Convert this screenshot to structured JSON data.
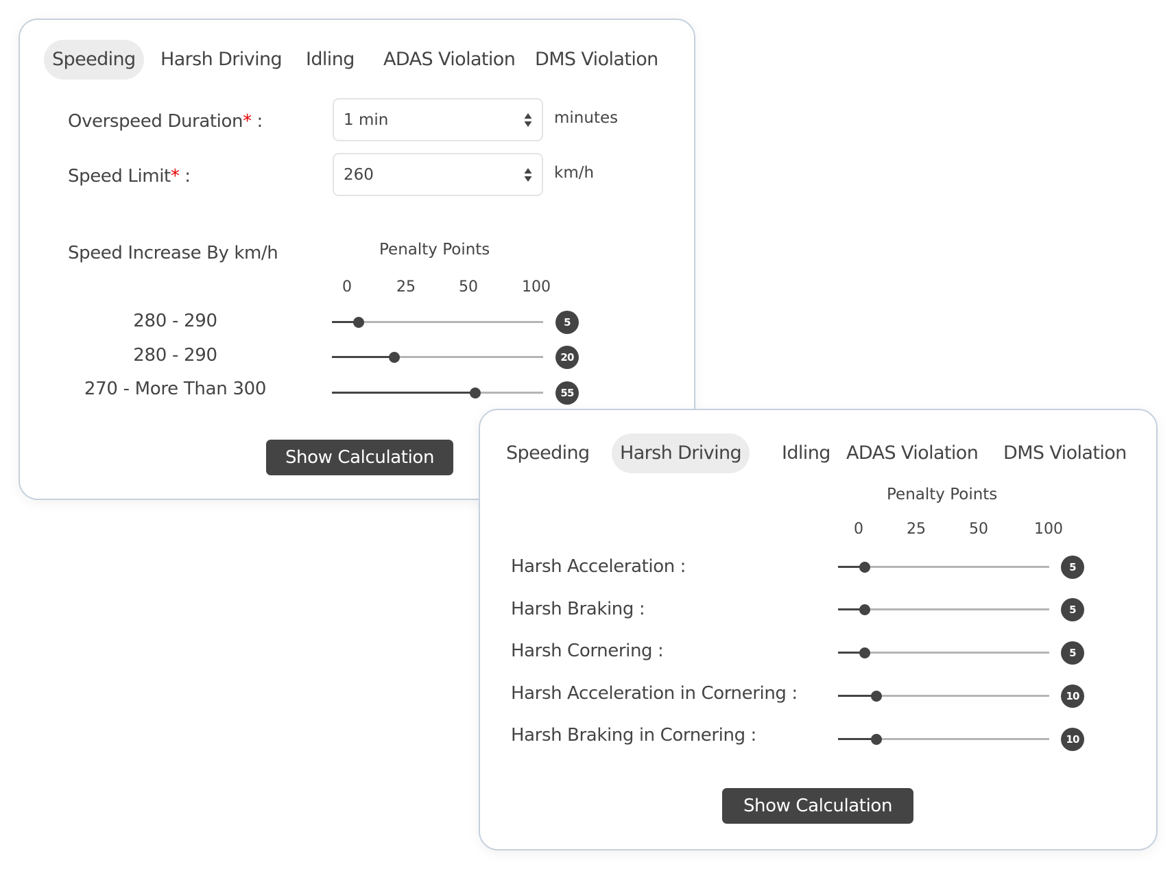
{
  "speeding_panel": {
    "tabs": [
      {
        "label": "Speeding",
        "active": true
      },
      {
        "label": "Harsh Driving",
        "active": false
      },
      {
        "label": "Idling",
        "active": false
      },
      {
        "label": "ADAS Violation",
        "active": false
      },
      {
        "label": "DMS Violation",
        "active": false
      }
    ],
    "overspeed_duration": {
      "label": "Overspeed Duration",
      "required_mark": "*",
      "suffix": " :",
      "value": "1 min",
      "unit": "minutes"
    },
    "speed_limit": {
      "label": "Speed Limit",
      "required_mark": "*",
      "suffix": " :",
      "value": "260",
      "unit": "km/h"
    },
    "range_header": "Speed Increase By km/h",
    "penalty_header": "Penalty Points",
    "scale_ticks": [
      "0",
      "25",
      "50",
      "100"
    ],
    "slider_max": 100,
    "rows": [
      {
        "label": "280 - 290",
        "value": 5,
        "badge": "5"
      },
      {
        "label": "280 - 290",
        "value": 20,
        "badge": "20"
      },
      {
        "label": "270 - More Than 300",
        "value": 55,
        "badge": "55"
      }
    ],
    "button_label": "Show Calculation"
  },
  "harsh_panel": {
    "tabs": [
      {
        "label": "Speeding",
        "active": false
      },
      {
        "label": "Harsh Driving",
        "active": true
      },
      {
        "label": "Idling",
        "active": false
      },
      {
        "label": "ADAS Violation",
        "active": false
      },
      {
        "label": "DMS Violation",
        "active": false
      }
    ],
    "penalty_header": "Penalty Points",
    "scale_ticks": [
      "0",
      "25",
      "50",
      "100"
    ],
    "slider_max": 100,
    "rows": [
      {
        "label": "Harsh Acceleration :",
        "value": 5,
        "badge": "5"
      },
      {
        "label": "Harsh Braking :",
        "value": 5,
        "badge": "5"
      },
      {
        "label": "Harsh Cornering :",
        "value": 5,
        "badge": "5"
      },
      {
        "label": "Harsh Acceleration in Cornering :",
        "value": 10,
        "badge": "10"
      },
      {
        "label": "Harsh Braking in Cornering :",
        "value": 10,
        "badge": "10"
      }
    ],
    "button_label": "Show Calculation"
  },
  "colors": {
    "accent": "#444444",
    "required": "#e50000",
    "active_tab_bg": "#ececec",
    "card_border": "#c5d1dd",
    "track": "#b5b5b5"
  }
}
